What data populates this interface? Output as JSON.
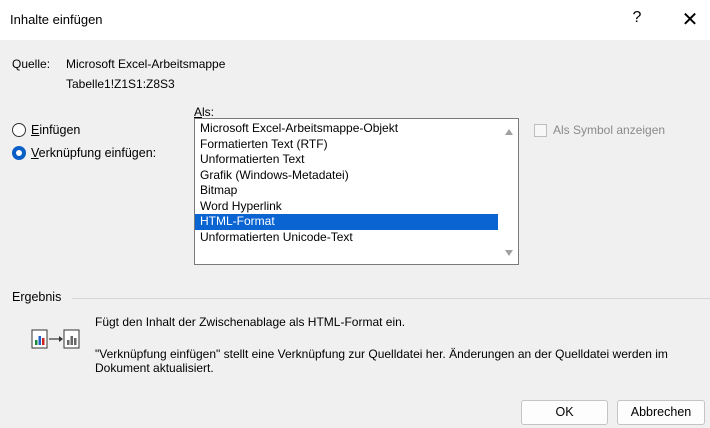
{
  "window": {
    "title": "Inhalte einfügen",
    "help": "?",
    "close": "✕"
  },
  "source": {
    "label": "Quelle:",
    "value_line1": "Microsoft Excel-Arbeitsmappe",
    "value_line2": "Tabelle1!Z1S1:Z8S3"
  },
  "options": {
    "paste": {
      "accel": "E",
      "rest": "infügen",
      "checked": false
    },
    "paste_link": {
      "accel": "V",
      "rest": "erknüpfung einfügen:",
      "checked": true
    }
  },
  "as_list": {
    "label_accel": "A",
    "label_rest": "ls:",
    "items": [
      {
        "label": "Microsoft Excel-Arbeitsmappe-Objekt",
        "selected": false
      },
      {
        "label": "Formatierten Text (RTF)",
        "selected": false
      },
      {
        "label": "Unformatierten Text",
        "selected": false
      },
      {
        "label": "Grafik (Windows-Metadatei)",
        "selected": false
      },
      {
        "label": "Bitmap",
        "selected": false
      },
      {
        "label": "Word Hyperlink",
        "selected": false
      },
      {
        "label": "HTML-Format",
        "selected": true
      },
      {
        "label": "Unformatierten Unicode-Text",
        "selected": false
      }
    ]
  },
  "display_as_icon": {
    "label": "Als Symbol anzeigen",
    "checked": false,
    "disabled": true
  },
  "result": {
    "heading": "Ergebnis",
    "text1": "Fügt den Inhalt der Zwischenablage als HTML-Format ein.",
    "text2": "\"Verknüpfung einfügen\" stellt eine Verknüpfung zur Quelldatei her. Änderungen an der Quelldatei werden im Dokument aktualisiert."
  },
  "buttons": {
    "ok": "OK",
    "cancel": "Abbrechen"
  },
  "colors": {
    "selection": "#0a64d2",
    "radio_checked": "#0a5fc6",
    "dialog_bg": "#f0f0f0"
  }
}
